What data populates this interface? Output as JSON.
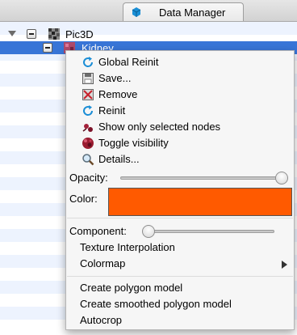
{
  "window": {
    "tab_label": "Data Manager",
    "tab_icon": "data-manager-icon"
  },
  "tree": {
    "rows": [
      {
        "label": "Pic3D",
        "icon": "image-volume-icon",
        "expanded": true,
        "checked": "partial"
      },
      {
        "label": "Kidney",
        "icon": "segmentation-icon",
        "selected": true,
        "checked": "partial"
      }
    ]
  },
  "context_menu": {
    "items": [
      {
        "label": "Global Reinit",
        "icon": "refresh-icon"
      },
      {
        "label": "Save...",
        "icon": "save-icon"
      },
      {
        "label": "Remove",
        "icon": "remove-icon"
      },
      {
        "label": "Reinit",
        "icon": "refresh-icon"
      },
      {
        "label": "Show only selected nodes",
        "icon": "show-selected-icon"
      },
      {
        "label": "Toggle visibility",
        "icon": "visibility-icon"
      },
      {
        "label": "Details...",
        "icon": "magnifier-icon"
      }
    ],
    "opacity": {
      "label": "Opacity:",
      "value": 1.0
    },
    "color": {
      "label": "Color:",
      "value": "#ff5a00"
    },
    "component": {
      "label": "Component:",
      "value": 0.0
    },
    "texture_interpolation_label": "Texture Interpolation",
    "colormap_label": "Colormap",
    "actions": [
      {
        "label": "Create polygon model"
      },
      {
        "label": "Create smoothed polygon model"
      },
      {
        "label": "Autocrop"
      }
    ]
  }
}
